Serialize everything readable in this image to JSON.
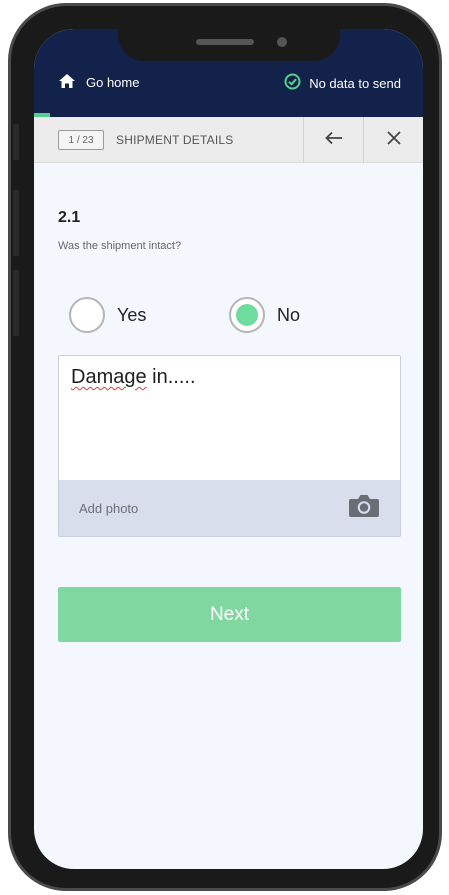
{
  "header": {
    "go_home_label": "Go home",
    "status_label": "No data to send",
    "accent_color": "#55d08f"
  },
  "subheader": {
    "counter": "1 / 23",
    "title": "SHIPMENT DETAILS",
    "back_icon": "arrow-left-icon",
    "close_icon": "close-icon"
  },
  "question": {
    "number": "2.1",
    "text": "Was the shipment intact?",
    "options": [
      {
        "label": "Yes",
        "selected": false
      },
      {
        "label": "No",
        "selected": true
      }
    ]
  },
  "answer": {
    "value_word": "Damage",
    "value_rest": " in.....",
    "add_photo_label": "Add photo",
    "photo_icon": "camera-icon"
  },
  "footer": {
    "next_label": "Next"
  }
}
